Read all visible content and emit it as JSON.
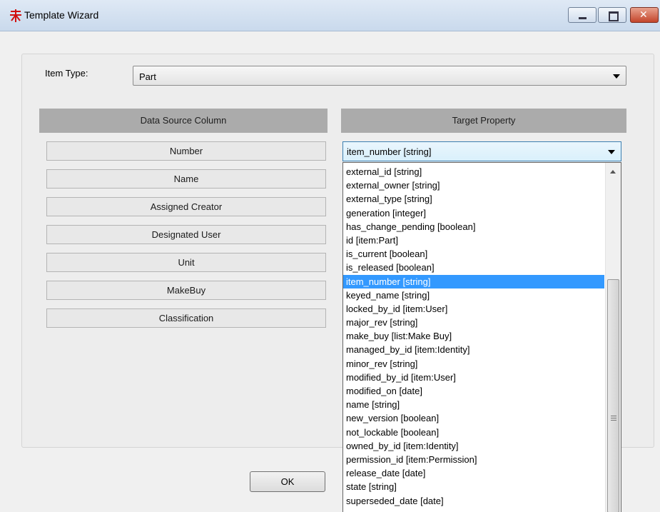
{
  "window": {
    "title": "Template Wizard",
    "icon": "aras-app-icon"
  },
  "form": {
    "item_type_label": "Item Type:",
    "item_type_value": "Part"
  },
  "columns": {
    "source_header": "Data Source Column",
    "target_header": "Target Property"
  },
  "source_columns": [
    "Number",
    "Name",
    "Assigned Creator",
    "Designated User",
    "Unit",
    "MakeBuy",
    "Classification"
  ],
  "target": {
    "selected_value": "item_number  [string]",
    "options": [
      "external_id  [string]",
      "external_owner  [string]",
      "external_type  [string]",
      "generation  [integer]",
      "has_change_pending  [boolean]",
      "id  [item:Part]",
      "is_current  [boolean]",
      "is_released  [boolean]",
      "item_number  [string]",
      "keyed_name  [string]",
      "locked_by_id  [item:User]",
      "major_rev  [string]",
      "make_buy  [list:Make Buy]",
      "managed_by_id  [item:Identity]",
      "minor_rev  [string]",
      "modified_by_id  [item:User]",
      "modified_on  [date]",
      "name  [string]",
      "new_version  [boolean]",
      "not_lockable  [boolean]",
      "owned_by_id  [item:Identity]",
      "permission_id  [item:Permission]",
      "release_date  [date]",
      "state  [string]",
      "superseded_date  [date]"
    ],
    "highlighted_index": 8
  },
  "buttons": {
    "ok": "OK"
  }
}
